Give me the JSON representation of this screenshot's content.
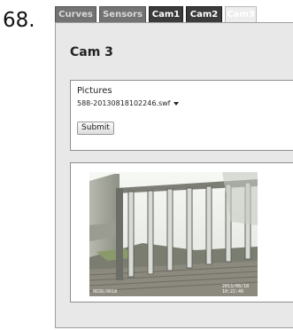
{
  "item_number": "68.",
  "tabs": [
    {
      "label": "Curves",
      "state": "inactive"
    },
    {
      "label": "Sensors",
      "state": "inactive"
    },
    {
      "label": "Cam1",
      "state": "normal"
    },
    {
      "label": "Cam2",
      "state": "normal"
    },
    {
      "label": "Cam3",
      "state": "active"
    }
  ],
  "page_title": "Cam 3",
  "form": {
    "pictures_label": "Pictures",
    "selected_file": "588-20130818102246.swf",
    "submit_label": "Submit"
  },
  "camera_image": {
    "overlay_left": "0030/0018",
    "overlay_right_line1": "2013/08/18",
    "overlay_right_line2": "10:22:46"
  },
  "colors": {
    "tab_dark": "#3b3b3b",
    "tab_inactive": "#737373",
    "panel_bg": "#e8e8e8"
  }
}
